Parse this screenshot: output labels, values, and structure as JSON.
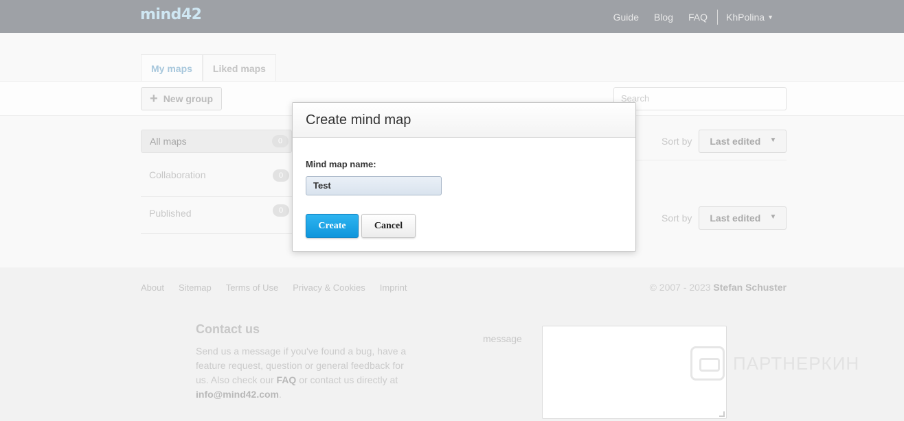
{
  "header": {
    "logo": "mind42",
    "nav": [
      "Guide",
      "Blog",
      "FAQ"
    ],
    "user": "KhPolina"
  },
  "tabs": [
    {
      "label": "My maps",
      "active": true
    },
    {
      "label": "Liked maps",
      "active": false
    }
  ],
  "toolbar": {
    "new_group_label": "New group",
    "search_placeholder": "Search"
  },
  "sidebar": {
    "items": [
      {
        "label": "All maps",
        "count": "0"
      },
      {
        "label": "Collaboration",
        "count": "0"
      },
      {
        "label": "Published",
        "count": "0"
      }
    ]
  },
  "sort": {
    "label": "Sort by",
    "value": "Last edited"
  },
  "dialog": {
    "title": "Create mind map",
    "field_label": "Mind map name:",
    "field_value": "Test",
    "create_label": "Create",
    "cancel_label": "Cancel"
  },
  "footer": {
    "links": [
      "About",
      "Sitemap",
      "Terms of Use",
      "Privacy & Cookies",
      "Imprint"
    ],
    "copyright_prefix": "© 2007 - 2023",
    "copyright_name": "Stefan Schuster",
    "contact_title": "Contact us",
    "contact_text_1": "Send us a message if you've found a bug, have a feature request, question or general feedback for us. Also check our",
    "contact_faq": "FAQ",
    "contact_text_2": "or contact us directly at",
    "contact_email": "info@mind42.com",
    "contact_text_3": ".",
    "message_label": "message"
  },
  "watermark": "ПАРТНЕРКИН",
  "colors": {
    "create_button": "#1aa3e6",
    "header_bg": "#9ea1a6"
  }
}
